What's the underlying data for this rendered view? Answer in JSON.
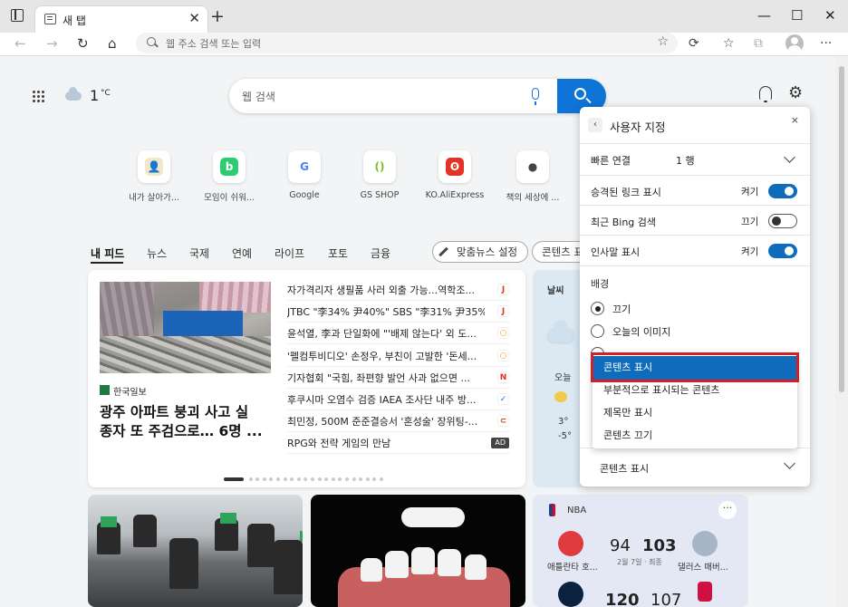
{
  "browser": {
    "tab_title": "새 탭",
    "new_tab_glyph": "+",
    "tab_close_glyph": "✕",
    "address_placeholder": "웹 주소 검색 또는 입력",
    "window_controls": {
      "minimize": "—",
      "maximize": "☐",
      "close": "✕"
    },
    "nav_icons": [
      "back-icon",
      "forward-icon",
      "refresh-icon",
      "home-icon"
    ],
    "toolbar_icons": [
      "favorite-add-icon",
      "extensions-icon",
      "favorites-icon",
      "collections-icon",
      "profile-icon",
      "more-icon"
    ]
  },
  "topbar": {
    "weather_temp": "1",
    "weather_unit": "°C",
    "search_placeholder": "웹 검색",
    "accent_color": "#0f74d8"
  },
  "quick_links": [
    {
      "label": "내가 살아가...",
      "mark": "👤",
      "color": "#f1e7c9"
    },
    {
      "label": "모임이 쉬워...",
      "mark": "b",
      "color": "#2ecc71"
    },
    {
      "label": "Google",
      "mark": "G",
      "color": "#ffffff"
    },
    {
      "label": "GS SHOP",
      "mark": "()",
      "color": "#ffffff"
    },
    {
      "label": "KO.AliExpress",
      "mark": "ʘ",
      "color": "#e43226"
    },
    {
      "label": "책의 세상에 ...",
      "mark": "●",
      "color": "#ffffff"
    }
  ],
  "feed_nav": {
    "items": [
      "내 피드",
      "뉴스",
      "국제",
      "연예",
      "라이프",
      "포토",
      "금융"
    ],
    "personalize": "맞춤뉴스 설정",
    "content_pill": "콘텐츠 표시"
  },
  "news": {
    "source": "한국일보",
    "headline": "광주 아파트 붕괴 사고 실종자 또 주검으로… 6명 ...",
    "headline_line1": "광주 아파트 붕괴 사고 실",
    "headline_line2": "종자 또 주검으로… 6명 ...",
    "list": [
      {
        "text": "자가격리자 생필품 사러 외출 가능...역학조...",
        "badge": "J",
        "badge_color": "#d93c1f"
      },
      {
        "text": "JTBC \"李34% 尹40%\" SBS \"李31% 尹35%\" ...",
        "badge": "J",
        "badge_color": "#d93c1f"
      },
      {
        "text": "윤석열, 李과 단일화에 \"'배제 않는다' 외 도...",
        "badge": "○",
        "badge_color": "#f0a21c"
      },
      {
        "text": "'펠컴투비디오' 손정우, 부친이 고발한 '돈세...",
        "badge": "○",
        "badge_color": "#f0a21c"
      },
      {
        "text": "기자협회 \"국힘, 좌편향 발언 사과 없으면 ...",
        "badge": "N",
        "badge_color": "#e0301e"
      },
      {
        "text": "후쿠시마 오염수 검증 IAEA 조사단 내주 방...",
        "badge": "✓",
        "badge_color": "#1a73e8"
      },
      {
        "text": "최민정, 500M 준준결승서 '혼성술' 장위팅-...",
        "badge": "⊂",
        "badge_color": "#d93c1f"
      },
      {
        "text": "RPG와 전략 게임의 만남",
        "badge": "AD",
        "badge_color": "#444444"
      }
    ],
    "pager_total": 21,
    "pager_active": 1
  },
  "weather_card": {
    "title": "날씨",
    "today": "오늘",
    "high": "3°",
    "low": "-5°"
  },
  "nba_card": {
    "label": "NBA",
    "more": "···",
    "game1": {
      "home": "애틀란타 호...",
      "home_score": "94",
      "away": "댈러스 매버...",
      "away_score": "103",
      "date": "2월 7일 · 최종"
    },
    "game2": {
      "home_score": "120",
      "away_score": "107"
    }
  },
  "customize_panel": {
    "title": "사용자 지정",
    "close_glyph": "×",
    "back_glyph": "‹",
    "quick_links_label": "빠른 연결",
    "quick_links_value": "1 행",
    "toggles": [
      {
        "label": "승격된 링크 표시",
        "state": "켜기",
        "on": true
      },
      {
        "label": "최근 Bing 검색",
        "state": "끄기",
        "on": false
      },
      {
        "label": "인사말 표시",
        "state": "켜기",
        "on": true
      }
    ],
    "background_label": "배경",
    "background_options": [
      {
        "label": "끄기",
        "checked": true
      },
      {
        "label": "오늘의 이미지",
        "checked": false
      }
    ],
    "content_label": "콘텐츠 표시"
  },
  "content_dropdown": {
    "options": [
      "콘텐츠 표시",
      "부분적으로 표시되는 콘텐츠",
      "제목만 표시",
      "콘텐츠 끄기"
    ],
    "selected_index": 0,
    "highlight_color": "#d0212a"
  }
}
